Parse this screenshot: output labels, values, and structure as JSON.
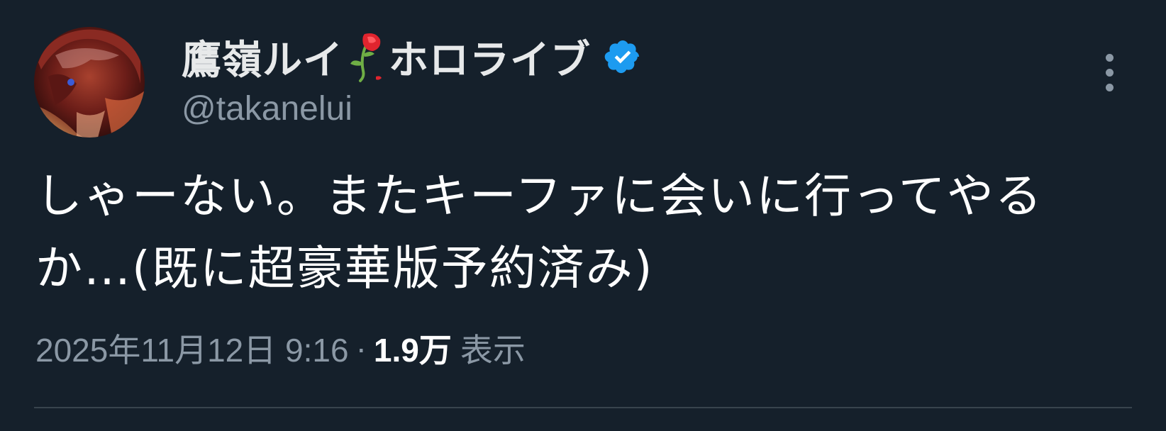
{
  "author": {
    "display_name": "鷹嶺ルイ",
    "display_name_suffix": "ホロライブ",
    "name_emoji": "wilted-rose-icon",
    "verified_icon": "verified-badge-icon",
    "handle": "@takanelui",
    "avatar_icon": "avatar-anime-character"
  },
  "tweet": {
    "text": "しゃーない。またキーファに会いに行ってやるか…(既に超豪華版予約済み)",
    "more_icon": "more-vertical-icon"
  },
  "meta": {
    "timestamp": "2025年11月12日 9:16",
    "separator": "·",
    "views_count": "1.9万",
    "views_label": "表示"
  },
  "colors": {
    "background": "#15202b",
    "verified": "#1d9bf0",
    "secondary_text": "#8b98a5",
    "primary_text": "#ffffff",
    "divider": "#38444d"
  }
}
